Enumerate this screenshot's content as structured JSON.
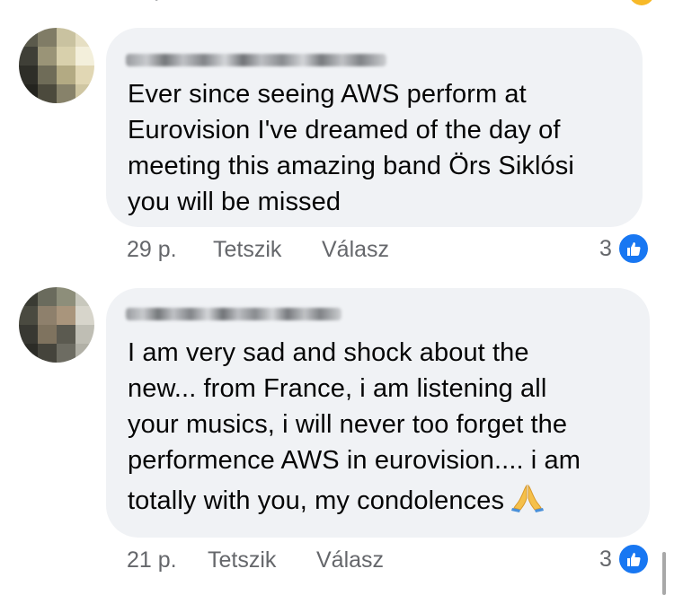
{
  "top_fragment": "·",
  "comments": [
    {
      "text": "Ever since seeing AWS perform at\nEurovision I've dreamed of the day of\nmeeting this amazing band Örs Siklósi\nyou will be missed",
      "time": "29 p.",
      "like_label": "Tetszik",
      "reply_label": "Válasz",
      "reaction_count": "3"
    },
    {
      "text": "I am very sad and shock about the\nnew... from France, i am listening all\nyour musics, i will never too forget the\nperformence AWS in eurovision.... i am\ntotally with you, my condolences",
      "time": "21 p.",
      "like_label": "Tetszik",
      "reply_label": "Válasz",
      "reaction_count": "3",
      "emoji": "folded-hands-icon"
    }
  ],
  "colors": {
    "bubble": "#f0f2f5",
    "meta": "#65676b",
    "like_blue": "#1877f2"
  }
}
